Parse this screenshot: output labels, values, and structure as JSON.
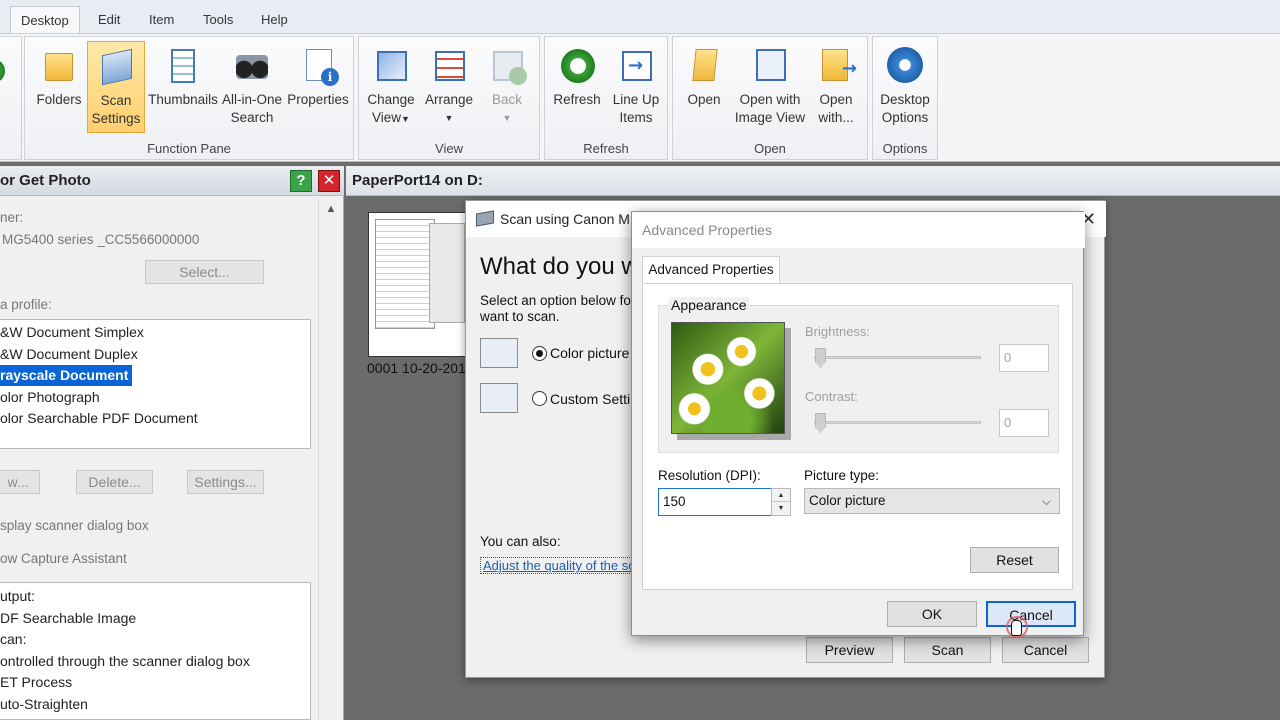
{
  "menu": {
    "items": [
      "Desktop",
      "Edit",
      "Item",
      "Tools",
      "Help"
    ]
  },
  "ribbon": {
    "groups": {
      "function_pane": "Function Pane",
      "view": "View",
      "refresh": "Refresh",
      "open": "Open",
      "options": "Options"
    },
    "buttons": {
      "folders": "Folders",
      "scan_settings_1": "Scan",
      "scan_settings_2": "Settings",
      "thumbnails": "Thumbnails",
      "allinone_1": "All-in-One",
      "allinone_2": "Search",
      "properties": "Properties",
      "change_view_1": "Change",
      "change_view_2": "View",
      "arrange": "Arrange",
      "back": "Back",
      "refresh": "Refresh",
      "line_up_1": "Line Up",
      "line_up_2": "Items",
      "open": "Open",
      "open_iv_1": "Open with",
      "open_iv_2": "Image View",
      "open_with_1": "Open",
      "open_with_2": "with...",
      "desktop_options_1": "Desktop",
      "desktop_options_2": "Options"
    }
  },
  "left_panel": {
    "title": "or Get Photo",
    "scanner_label": "ner:",
    "scanner_value": "MG5400 series _CC5566000000",
    "select_button": "Select...",
    "profile_label": "a profile:",
    "profiles": [
      "&W Document Simplex",
      "&W Document Duplex",
      "rayscale Document",
      "olor Photograph",
      "olor Searchable PDF Document"
    ],
    "new_button": "w...",
    "delete_button": "Delete...",
    "settings_button": "Settings...",
    "display_dialog": "splay scanner dialog box",
    "capture_assistant": "ow Capture Assistant",
    "output_lines": [
      "utput:",
      "DF Searchable Image",
      "can:",
      "ontrolled through the scanner dialog box",
      "ET Process",
      "uto-Straighten"
    ]
  },
  "main": {
    "title": "PaperPort14 on D:",
    "thumbnail_label": "0001 10-20-201"
  },
  "scan_dialog": {
    "title": "Scan using Canon M",
    "heading": "What do you w",
    "subtext": "Select an option below for want to scan.",
    "option_color": "Color picture",
    "option_custom": "Custom Setting",
    "also": "You can also:",
    "adjust_link": "Adjust the quality of the sc",
    "preview_button": "Preview",
    "scan_button": "Scan",
    "cancel_button": "Cancel"
  },
  "adv_dialog": {
    "title": "Advanced Properties",
    "tab": "Advanced Properties",
    "appearance": "Appearance",
    "brightness_label": "Brightness:",
    "brightness_value": "0",
    "contrast_label": "Contrast:",
    "contrast_value": "0",
    "resolution_label": "Resolution (DPI):",
    "resolution_value": "150",
    "picture_type_label": "Picture type:",
    "picture_type_value": "Color picture",
    "reset_button": "Reset",
    "ok_button": "OK",
    "cancel_button": "Cancel"
  }
}
